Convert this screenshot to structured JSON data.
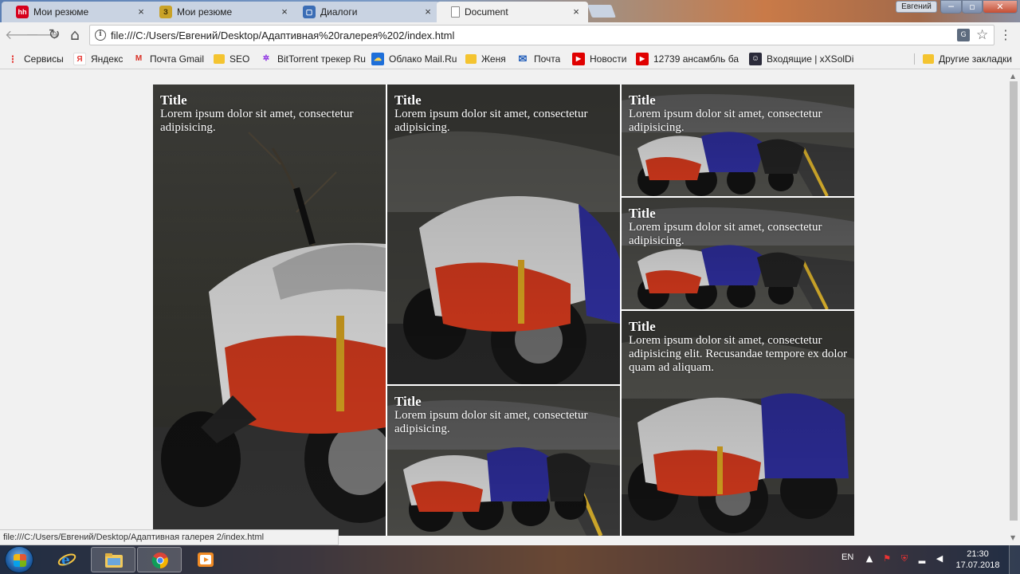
{
  "tabs": [
    {
      "label": "Мои резюме",
      "favicon": "hh",
      "favicon_color": "#d6001c"
    },
    {
      "label": "Мои резюме",
      "favicon": "З",
      "favicon_color": "#c9a227"
    },
    {
      "label": "Диалоги",
      "favicon": "▢",
      "favicon_color": "#3b6db5"
    },
    {
      "label": "Document",
      "favicon": "",
      "favicon_color": "#ffffff"
    }
  ],
  "tab_close_glyph": "×",
  "window": {
    "profile_name": "Евгений",
    "minimize": "─",
    "maximize": "▫",
    "close": "✕"
  },
  "toolbar": {
    "back_icon": "🡐",
    "forward_icon": "🡒",
    "reload_icon": "↻",
    "home_icon": "⌂",
    "url": "file:///C:/Users/Евгений/Desktop/Адаптивная%20галерея%202/index.html",
    "info_glyph": "i",
    "translate_glyph": "G",
    "star_glyph": "☆",
    "menu_glyph": "⋮"
  },
  "bookmarks": [
    {
      "label": "Сервисы",
      "icon_color": "#e53935",
      "glyph": "⁝"
    },
    {
      "label": "Яндекс",
      "icon_color": "#ffffff",
      "glyph": "Я"
    },
    {
      "label": "Почта Gmail",
      "icon_color": "#ffffff",
      "glyph": "M"
    },
    {
      "label": "SEO",
      "icon_color": "#f4c430",
      "glyph": ""
    },
    {
      "label": "BitTorrent трекер Ru",
      "icon_color": "#ffffff",
      "glyph": "✲"
    },
    {
      "label": "Облако Mail.Ru",
      "icon_color": "#1e6fd9",
      "glyph": "☁"
    },
    {
      "label": "Женя",
      "icon_color": "#f4c430",
      "glyph": ""
    },
    {
      "label": "Почта",
      "icon_color": "#ffffff",
      "glyph": "✉"
    },
    {
      "label": "Новости",
      "icon_color": "#e00000",
      "glyph": "▶"
    },
    {
      "label": "12739 ансамбль ба",
      "icon_color": "#e00000",
      "glyph": "▶"
    },
    {
      "label": "Входящие | xXSolDi",
      "icon_color": "#2b2b3a",
      "glyph": "☺"
    },
    {
      "label": "Другие закладки",
      "icon_color": "#f4c430",
      "glyph": ""
    }
  ],
  "gallery": [
    {
      "title": "Title",
      "text": "Lorem ipsum dolor sit amet, consectetur adipisicing."
    },
    {
      "title": "Title",
      "text": "Lorem ipsum dolor sit amet, consectetur adipisicing."
    },
    {
      "title": "Title",
      "text": "Lorem ipsum dolor sit amet, consectetur adipisicing."
    },
    {
      "title": "Title",
      "text": "Lorem ipsum dolor sit amet, consectetur adipisicing."
    },
    {
      "title": "Title",
      "text": "Lorem ipsum dolor sit amet, consectetur adipisicing elit. Recusandae tempore ex dolor quam ad aliquam."
    },
    {
      "title": "Title",
      "text": "Lorem ipsum dolor sit amet, consectetur adipisicing."
    }
  ],
  "status_bar": "file:///C:/Users/Евгений/Desktop/Адаптивная галерея 2/index.html",
  "taskbar": {
    "lang": "EN",
    "time": "21:30",
    "date": "17.07.2018"
  }
}
